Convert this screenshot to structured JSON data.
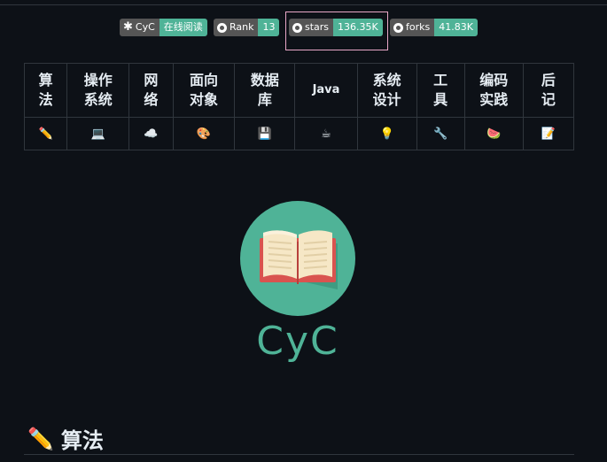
{
  "badges": [
    {
      "left": "CyC",
      "right": "在线阅读",
      "icon": "asterisk-icon"
    },
    {
      "left": "Rank",
      "right": "13",
      "icon": "github-icon"
    },
    {
      "left": "stars",
      "right": "136.35K",
      "icon": "github-icon"
    },
    {
      "left": "forks",
      "right": "41.83K",
      "icon": "github-icon"
    }
  ],
  "nav": {
    "headers": [
      "算\n法",
      "操作\n系统",
      "网\n络",
      "面向\n对象",
      "数据\n库",
      "Java",
      "系统\n设计",
      "工\n具",
      "编码\n实践",
      "后\n记"
    ],
    "icons": [
      "✏️",
      "💻",
      "☁️",
      "🎨",
      "💾",
      "☕",
      "💡",
      "🔧",
      "🍉",
      "📝"
    ]
  },
  "logo": {
    "text": "CyC"
  },
  "section": {
    "icon": "✏️",
    "title": "算法"
  },
  "colors": {
    "accent": "#4fb397",
    "badge_left": "#555555",
    "background": "#0d1117",
    "highlight": "#e8a7c7"
  }
}
